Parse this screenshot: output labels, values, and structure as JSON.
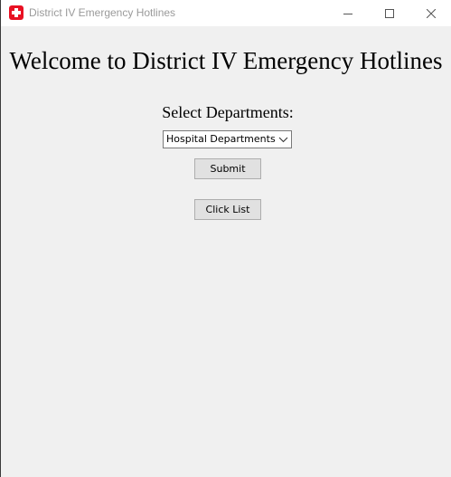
{
  "window": {
    "title": "District IV Emergency Hotlines",
    "icon": "red-cross-icon",
    "controls": [
      "minimize-icon",
      "maximize-icon",
      "close-icon"
    ]
  },
  "main": {
    "heading": "Welcome to District IV Emergency Hotlines",
    "select_label": "Select Departments:",
    "department_select": {
      "selected": "Hospital Departments"
    },
    "submit_label": "Submit",
    "click_list_label": "Click List"
  },
  "colors": {
    "window_background": "#f0f0f0",
    "titlebar_background": "#ffffff",
    "app_icon": "#e81123",
    "button_background": "#e1e1e1"
  }
}
